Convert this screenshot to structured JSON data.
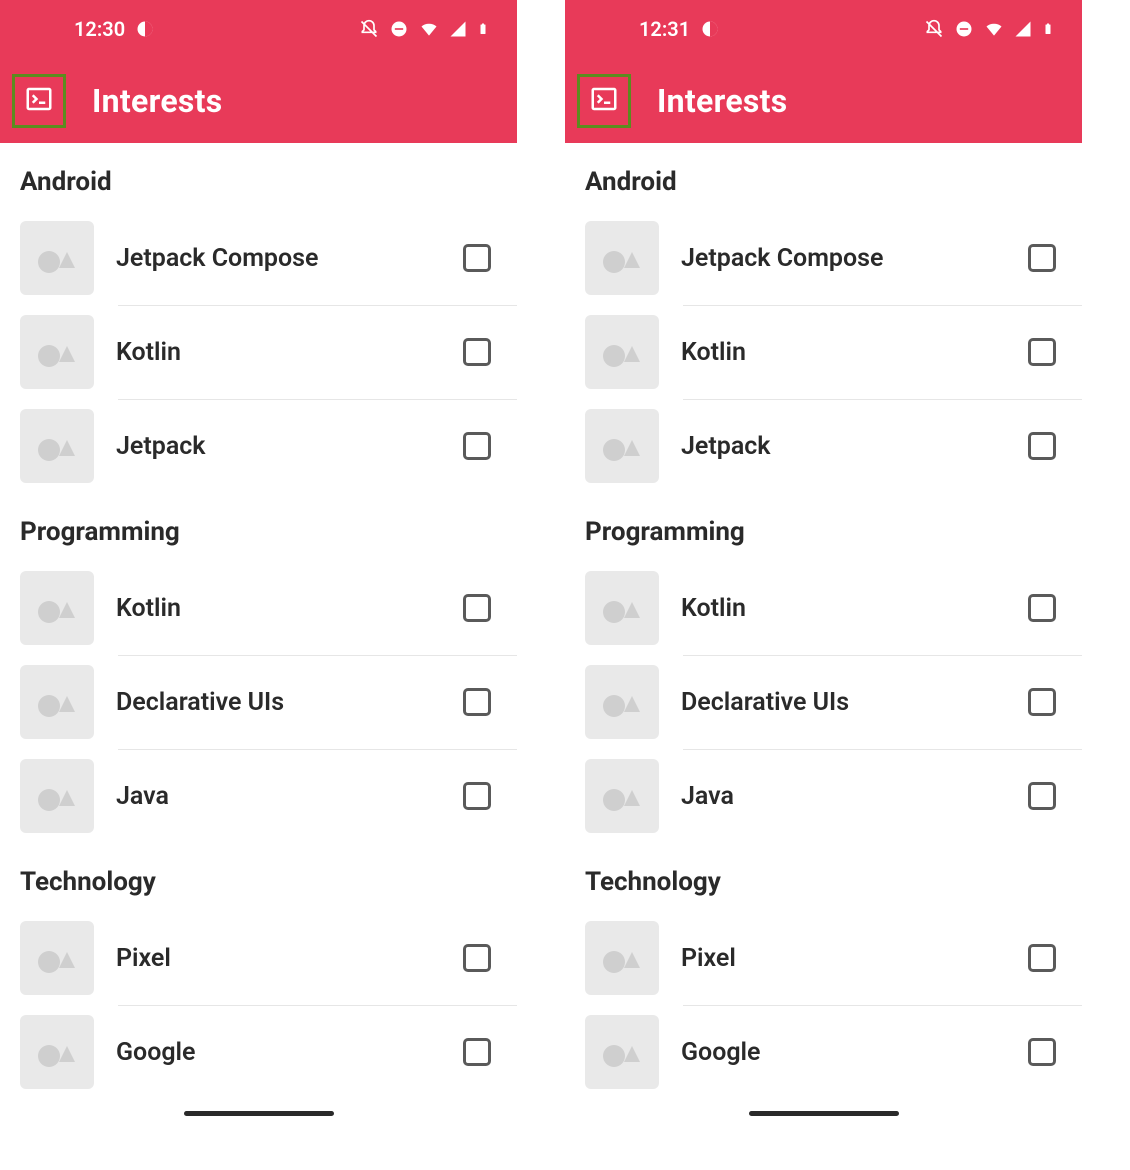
{
  "phones": [
    {
      "status": {
        "time": "12:30"
      },
      "appBar": {
        "title": "Interests"
      },
      "sections": [
        {
          "header": "Android",
          "items": [
            {
              "label": "Jetpack Compose",
              "checked": false
            },
            {
              "label": "Kotlin",
              "checked": false
            },
            {
              "label": "Jetpack",
              "checked": false
            }
          ]
        },
        {
          "header": "Programming",
          "items": [
            {
              "label": "Kotlin",
              "checked": false
            },
            {
              "label": "Declarative UIs",
              "checked": false
            },
            {
              "label": "Java",
              "checked": false
            }
          ]
        },
        {
          "header": "Technology",
          "items": [
            {
              "label": "Pixel",
              "checked": false
            },
            {
              "label": "Google",
              "checked": false
            }
          ]
        }
      ]
    },
    {
      "status": {
        "time": "12:31"
      },
      "appBar": {
        "title": "Interests"
      },
      "sections": [
        {
          "header": "Android",
          "items": [
            {
              "label": "Jetpack Compose",
              "checked": false
            },
            {
              "label": "Kotlin",
              "checked": false
            },
            {
              "label": "Jetpack",
              "checked": false
            }
          ]
        },
        {
          "header": "Programming",
          "items": [
            {
              "label": "Kotlin",
              "checked": false
            },
            {
              "label": "Declarative UIs",
              "checked": false
            },
            {
              "label": "Java",
              "checked": false
            }
          ]
        },
        {
          "header": "Technology",
          "items": [
            {
              "label": "Pixel",
              "checked": false
            },
            {
              "label": "Google",
              "checked": false
            }
          ]
        }
      ]
    }
  ]
}
